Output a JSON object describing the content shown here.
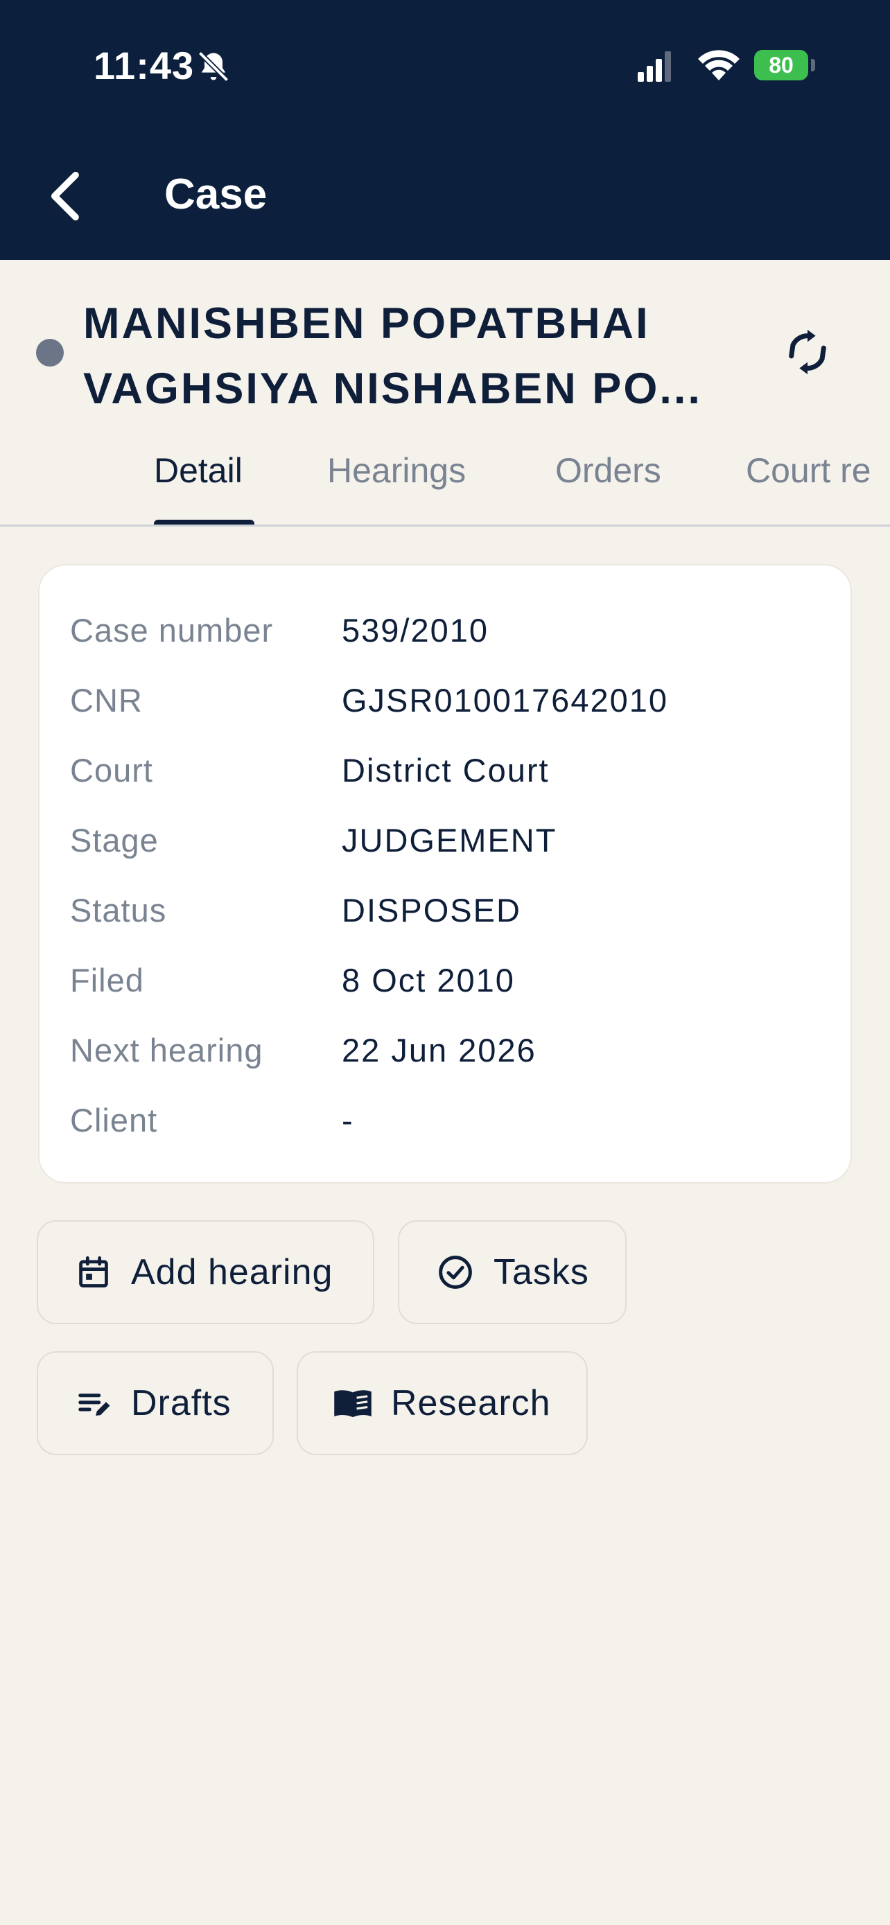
{
  "status_bar": {
    "time": "11:43",
    "battery": "80",
    "icons": [
      "bell-off-icon",
      "cellular-signal-icon",
      "wifi-icon",
      "battery-charging-icon"
    ]
  },
  "header": {
    "title": "Case",
    "back_icon": "chevron-left-icon",
    "background": "#0c1f3c"
  },
  "case": {
    "title_line1": "MANISHBEN POPATBHAI",
    "title_line2": "VAGHSIYA NISHABEN PO...",
    "status_dot_color": "#6b7587",
    "sync_icon": "sync-icon"
  },
  "tabs": [
    {
      "label": "Detail",
      "active": true
    },
    {
      "label": "Hearings",
      "active": false
    },
    {
      "label": "Orders",
      "active": false
    },
    {
      "label": "Court re",
      "active": false
    }
  ],
  "details": [
    {
      "label": "Case number",
      "value": "539/2010"
    },
    {
      "label": "CNR",
      "value": "GJSR010017642010"
    },
    {
      "label": "Court",
      "value": "District Court"
    },
    {
      "label": "Stage",
      "value": "JUDGEMENT"
    },
    {
      "label": "Status",
      "value": "DISPOSED"
    },
    {
      "label": "Filed",
      "value": "8 Oct 2010"
    },
    {
      "label": "Next hearing",
      "value": "22 Jun 2026"
    },
    {
      "label": "Client",
      "value": "-"
    }
  ],
  "actions": {
    "add_hearing": {
      "label": "Add hearing",
      "icon": "calendar-icon"
    },
    "tasks": {
      "label": "Tasks",
      "icon": "check-circle-icon"
    },
    "drafts": {
      "label": "Drafts",
      "icon": "edit-note-icon"
    },
    "research": {
      "label": "Research",
      "icon": "book-icon"
    }
  }
}
